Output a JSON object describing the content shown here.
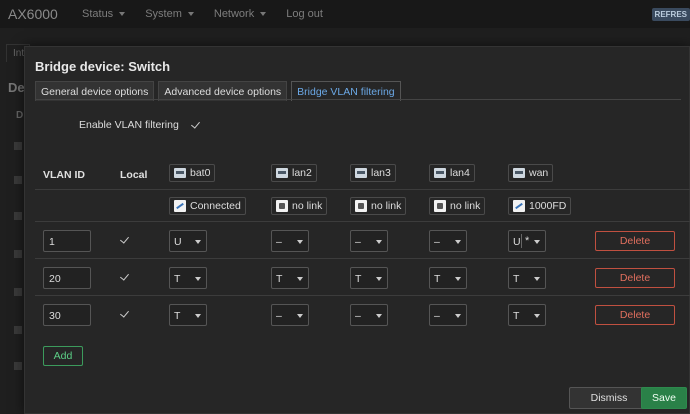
{
  "app": {
    "brand": "AX6000",
    "refresh_label": "REFRES",
    "menu": [
      {
        "label": "Status"
      },
      {
        "label": "System"
      },
      {
        "label": "Network"
      },
      {
        "label": "Log out"
      }
    ]
  },
  "background": {
    "tab_fragment": "Int",
    "heading_fragment": "De",
    "col_fragment": "D"
  },
  "modal": {
    "title": "Bridge device: Switch",
    "tabs": [
      {
        "label": "General device options",
        "active": false
      },
      {
        "label": "Advanced device options",
        "active": false
      },
      {
        "label": "Bridge VLAN filtering",
        "active": true
      }
    ],
    "enable_vlan_filtering": {
      "label": "Enable VLAN filtering",
      "checked": true
    },
    "columns": {
      "vlan_id": "VLAN ID",
      "local": "Local",
      "ports": [
        {
          "name": "bat0",
          "status": "Connected",
          "status_icon": "connected-icon"
        },
        {
          "name": "lan2",
          "status": "no link",
          "status_icon": "no-link-icon"
        },
        {
          "name": "lan3",
          "status": "no link",
          "status_icon": "no-link-icon"
        },
        {
          "name": "lan4",
          "status": "no link",
          "status_icon": "no-link-icon"
        },
        {
          "name": "wan",
          "status": "1000FD",
          "status_icon": "link-up-icon"
        }
      ]
    },
    "rows": [
      {
        "vlan_id": "1",
        "local": true,
        "ports": [
          "U",
          "–",
          "–",
          "–",
          "U"
        ],
        "wan_primary": true,
        "delete_label": "Delete"
      },
      {
        "vlan_id": "20",
        "local": true,
        "ports": [
          "T",
          "T",
          "T",
          "T",
          "T"
        ],
        "delete_label": "Delete"
      },
      {
        "vlan_id": "30",
        "local": true,
        "ports": [
          "T",
          "–",
          "–",
          "–",
          "T"
        ],
        "delete_label": "Delete"
      }
    ],
    "wan_primary_mark": "*",
    "add_label": "Add",
    "dismiss_label": "Dismiss",
    "save_label": "Save"
  },
  "colors": {
    "accent_tab": "#6ba8e5",
    "delete": "#e06f5e",
    "save": "#2a8148"
  }
}
